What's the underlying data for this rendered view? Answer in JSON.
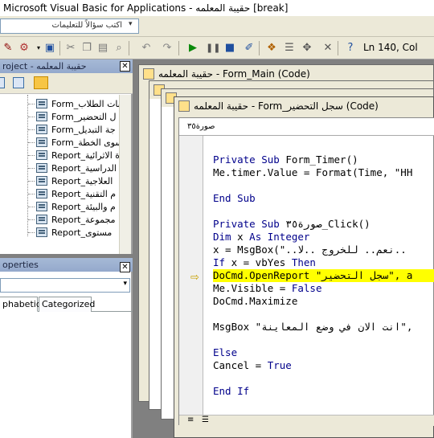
{
  "title": "Microsoft Visual Basic for Applications - حقيبة المعلمه [break]",
  "ask_placeholder": "اكتب سؤالاً للتعليمات",
  "status_position": "Ln 140, Col",
  "project": {
    "header": "roject - حقيبة المعلمه",
    "items": [
      {
        "label": "Form_بات الطلاب",
        "type": "form"
      },
      {
        "label": "Form_ل التحضير",
        "type": "form"
      },
      {
        "label": "Form_جة التبديل",
        "type": "form"
      },
      {
        "label": "Form_سوى الخطة",
        "type": "form"
      },
      {
        "label": "Report_ة الاثرائية",
        "type": "report"
      },
      {
        "label": "Report_الدراسية",
        "type": "report"
      },
      {
        "label": "Report_العلاجية",
        "type": "report"
      },
      {
        "label": "Report_م التقنية",
        "type": "report"
      },
      {
        "label": "Report_م والبيئة",
        "type": "report"
      },
      {
        "label": "Report_مجموعة",
        "type": "report"
      },
      {
        "label": "Report_مستوى",
        "type": "report"
      }
    ]
  },
  "properties": {
    "header": "operties",
    "tab_alpha": "phabetic",
    "tab_cat": "Categorized"
  },
  "windows": {
    "back1_title": "حقيبة المعلمه - Form_Main (Code)",
    "front_title": "حقيبة المعلمه - Form_سجل التحضير (Code)",
    "object_combo": "صورة٣٥"
  },
  "code_lines": [
    "",
    "Private Sub Form_Timer()",
    "Me.timer.Value = Format(Time, \"HH",
    "",
    "End Sub",
    "",
    "Private Sub صورة٣٥_Click()",
    "Dim x As Integer",
    "x = MsgBox(\"..نعم.. للخروج ..لا..",
    "If x = vbYes Then",
    "DoCmd.OpenReport \"سجل التحضير\", a",
    "Me.Visible = False",
    "DoCmd.Maximize",
    "",
    "MsgBox \"انت الان في وضع المعاينة\",",
    "",
    "Else",
    "Cancel = True",
    "",
    "End If"
  ],
  "colors": {
    "highlight": "#ffff00",
    "keyword": "#00008b"
  }
}
